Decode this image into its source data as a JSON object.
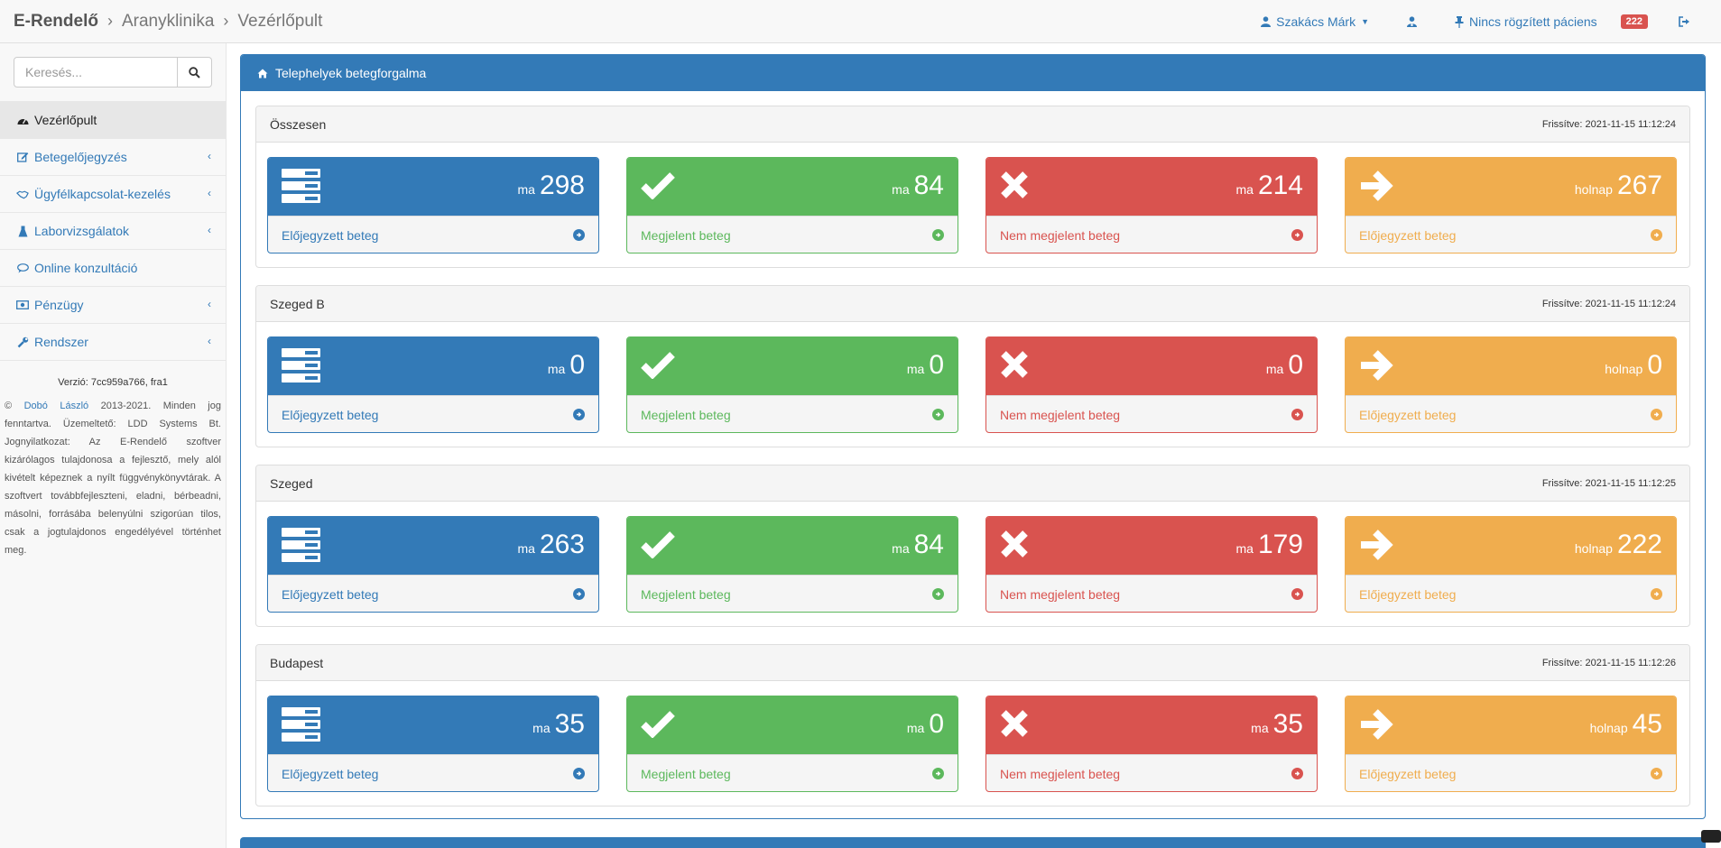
{
  "nav": {
    "app": "E-Rendelő",
    "clinic": "Aranyklinika",
    "page": "Vezérlőpult",
    "user": "Szakács Márk",
    "patient_status": "Nincs rögzített páciens",
    "notification_count": "222"
  },
  "search": {
    "placeholder": "Keresés..."
  },
  "sidebar": {
    "items": [
      {
        "label": "Vezérlőpult"
      },
      {
        "label": "Betegelőjegyzés"
      },
      {
        "label": "Ügyfélkapcsolat-kezelés"
      },
      {
        "label": "Laborvizsgálatok"
      },
      {
        "label": "Online konzultáció"
      },
      {
        "label": "Pénzügy"
      },
      {
        "label": "Rendszer"
      }
    ],
    "version": "Verzió: 7cc959a766, fra1",
    "copyright_prefix": "© ",
    "copyright_author": "Dobó László",
    "copyright_text": " 2013-2021. Minden jog fenntartva. Üzemeltető: LDD Systems Bt. Jognyilatkozat: Az E-Rendelő szoftver kizárólagos tulajdonosa a fejlesztő, mely alól kivételt képeznek a nyílt függvénykönyvtárak. A szoftvert továbbfejleszteni, eladni, bérbeadni, másolni, forrásába belenyúlni szigorúan tilos, csak a jogtulajdonos engedélyével történhet meg."
  },
  "panel": {
    "title": "Telephelyek betegforgalma"
  },
  "labels": {
    "today": "ma",
    "tomorrow": "holnap",
    "booked": "Előjegyzett beteg",
    "appeared": "Megjelent beteg",
    "not_appeared": "Nem megjelent beteg"
  },
  "sites": [
    {
      "name": "Összesen",
      "refreshed": "Frissítve: 2021-11-15 11:12:24",
      "booked_today": "298",
      "appeared_today": "84",
      "not_appeared_today": "214",
      "booked_tomorrow": "267"
    },
    {
      "name": "Szeged B",
      "refreshed": "Frissítve: 2021-11-15 11:12:24",
      "booked_today": "0",
      "appeared_today": "0",
      "not_appeared_today": "0",
      "booked_tomorrow": "0"
    },
    {
      "name": "Szeged",
      "refreshed": "Frissítve: 2021-11-15 11:12:25",
      "booked_today": "263",
      "appeared_today": "84",
      "not_appeared_today": "179",
      "booked_tomorrow": "222"
    },
    {
      "name": "Budapest",
      "refreshed": "Frissítve: 2021-11-15 11:12:26",
      "booked_today": "35",
      "appeared_today": "0",
      "not_appeared_today": "35",
      "booked_tomorrow": "45"
    }
  ],
  "colors": {
    "primary": "#337ab7",
    "success": "#5cb85c",
    "danger": "#d9534f",
    "warning": "#f0ad4e"
  }
}
